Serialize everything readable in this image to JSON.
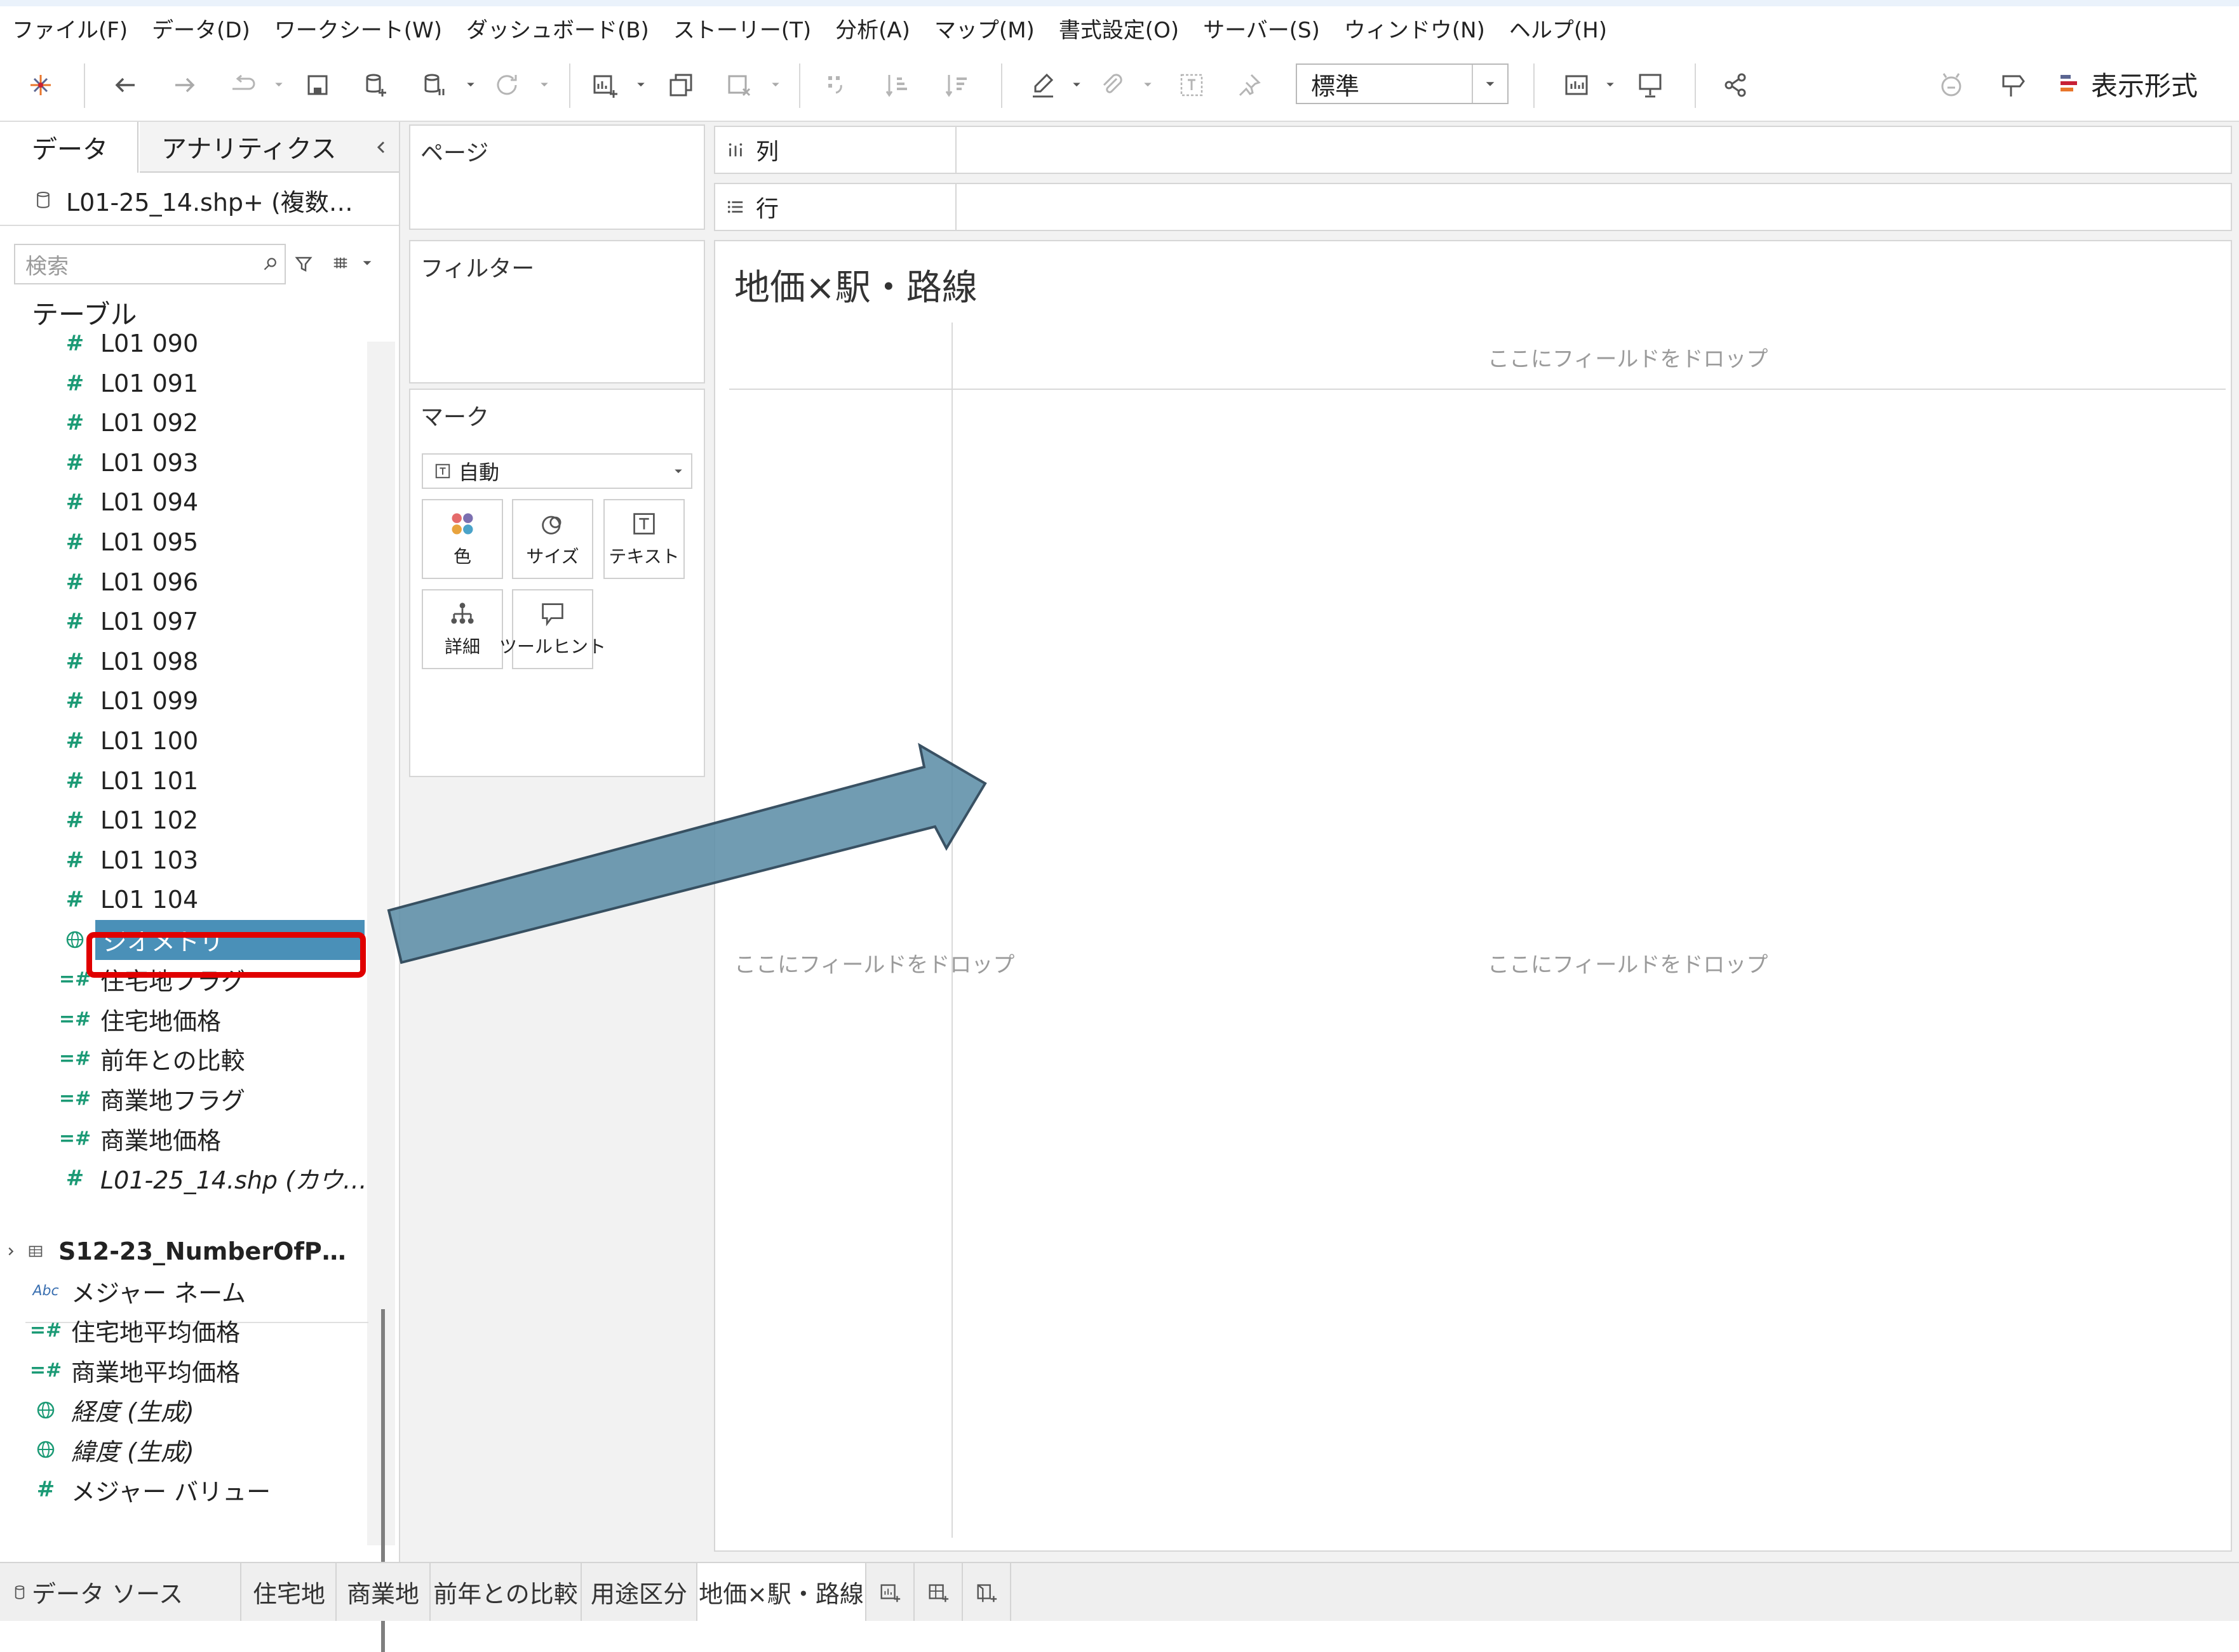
{
  "menu": [
    "ファイル(F)",
    "データ(D)",
    "ワークシート(W)",
    "ダッシュボード(B)",
    "ストーリー(T)",
    "分析(A)",
    "マップ(M)",
    "書式設定(O)",
    "サーバー(S)",
    "ウィンドウ(N)",
    "ヘルプ(H)"
  ],
  "toolbar": {
    "fit_value": "標準",
    "show_me_label": "表示形式"
  },
  "data_pane": {
    "tab_data": "データ",
    "tab_analytics": "アナリティクス",
    "datasource_name": "L01-25_14.shp+ (複数…",
    "search_placeholder": "検索",
    "tables_header": "テーブル",
    "fields": [
      {
        "name": "L01 090",
        "type": "measure"
      },
      {
        "name": "L01 091",
        "type": "measure"
      },
      {
        "name": "L01 092",
        "type": "measure"
      },
      {
        "name": "L01 093",
        "type": "measure"
      },
      {
        "name": "L01 094",
        "type": "measure"
      },
      {
        "name": "L01 095",
        "type": "measure"
      },
      {
        "name": "L01 096",
        "type": "measure"
      },
      {
        "name": "L01 097",
        "type": "measure"
      },
      {
        "name": "L01 098",
        "type": "measure"
      },
      {
        "name": "L01 099",
        "type": "measure"
      },
      {
        "name": "L01 100",
        "type": "measure"
      },
      {
        "name": "L01 101",
        "type": "measure"
      },
      {
        "name": "L01 102",
        "type": "measure"
      },
      {
        "name": "L01 103",
        "type": "measure"
      },
      {
        "name": "L01 104",
        "type": "measure"
      },
      {
        "name": "ジオメトリ",
        "type": "geo",
        "selected": true
      },
      {
        "name": "住宅地フラグ",
        "type": "calc-measure"
      },
      {
        "name": "住宅地価格",
        "type": "calc-measure"
      },
      {
        "name": "前年との比較",
        "type": "calc-measure"
      },
      {
        "name": "商業地フラグ",
        "type": "calc-measure"
      },
      {
        "name": "商業地価格",
        "type": "calc-measure"
      },
      {
        "name": "L01-25_14.shp (カウ…",
        "type": "measure",
        "italic": true
      }
    ],
    "second_table": "S12-23_NumberOfP…",
    "extra_fields": [
      {
        "name": "メジャー ネーム",
        "type": "abc"
      },
      {
        "name": "住宅地平均価格",
        "type": "calc-measure"
      },
      {
        "name": "商業地平均価格",
        "type": "calc-measure"
      },
      {
        "name": "経度 (生成)",
        "type": "geo",
        "italic": true
      },
      {
        "name": "緯度 (生成)",
        "type": "geo",
        "italic": true
      },
      {
        "name": "メジャー バリュー",
        "type": "measure"
      }
    ]
  },
  "shelves": {
    "pages": "ページ",
    "filters": "フィルター",
    "marks": "マーク",
    "marks_type": "自動",
    "marks_buttons": [
      "色",
      "サイズ",
      "テキスト",
      "詳細",
      "ツールヒント"
    ],
    "columns": "列",
    "rows": "行"
  },
  "view": {
    "title": "地価×駅・路線",
    "drop_top": "ここにフィールドをドロップ",
    "drop_left": "ここにフィールドをドロップ",
    "drop_center": "ここにフィールドをドロップ"
  },
  "bottom_tabs": {
    "datasource": "データ ソース",
    "sheets": [
      "住宅地",
      "商業地",
      "前年との比較",
      "用途区分",
      "地価×駅・路線"
    ]
  },
  "colors": {
    "selection": "#4a90b8",
    "highlight_box": "#e00000",
    "arrow_fill": "#5e8fa8",
    "measure_green": "#1b9a75"
  }
}
